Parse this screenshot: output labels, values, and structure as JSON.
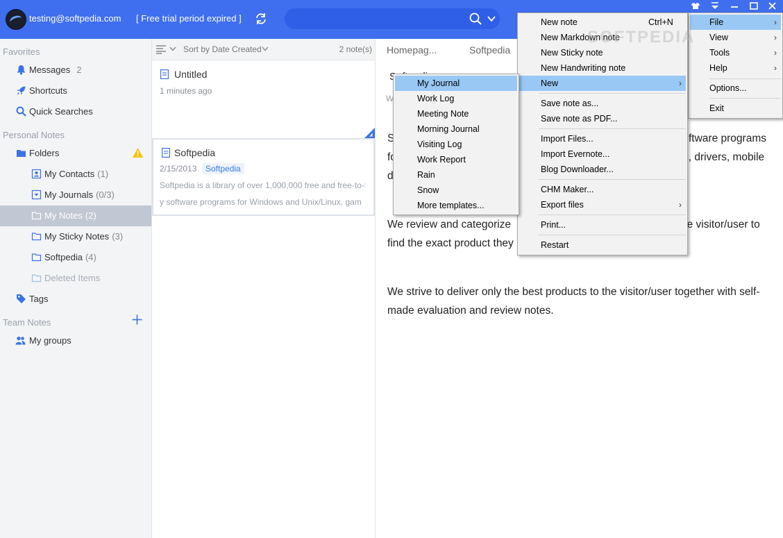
{
  "header": {
    "account_email": "testing@softpedia.com",
    "trial_status": "[ Free trial period expired ]",
    "search": {
      "value": "",
      "placeholder": ""
    }
  },
  "sidebar": {
    "favorites_label": "Favorites",
    "personal_label": "Personal Notes",
    "team_label": "Team Notes",
    "items": {
      "messages": {
        "label": "Messages",
        "count": "2"
      },
      "shortcuts": {
        "label": "Shortcuts"
      },
      "quick_searches": {
        "label": "Quick Searches"
      },
      "folders": {
        "label": "Folders"
      },
      "my_contacts": {
        "label": "My Contacts",
        "count": "(1)"
      },
      "my_journals": {
        "label": "My Journals",
        "count": "(0/3)"
      },
      "my_notes": {
        "label": "My Notes",
        "count": "(2)"
      },
      "my_sticky_notes": {
        "label": "My Sticky Notes",
        "count": "(3)"
      },
      "softpedia": {
        "label": "Softpedia",
        "count": "(4)"
      },
      "deleted_items": {
        "label": "Deleted Items"
      },
      "tags": {
        "label": "Tags"
      },
      "my_groups": {
        "label": "My groups"
      }
    }
  },
  "notelist": {
    "sort_label": "Sort by Date Created",
    "count_label": "2 note(s)",
    "notes": [
      {
        "title": "Untitled",
        "meta": "1 minutes ago"
      },
      {
        "title": "Softpedia",
        "date": "2/15/2013",
        "tag": "Softpedia",
        "snippet1": "Softpedia is a library of over 1,000,000 free and free-to-tr",
        "snippet2": "y software programs for Windows and Unix/Linux, gam"
      }
    ]
  },
  "editor": {
    "tabs": [
      "Homepag...",
      "Softpedia"
    ],
    "title_partial": "Softpedi",
    "sub_partial": "W",
    "p1_l1": "S",
    "p1_l1_right": "ftware programs",
    "p1_l2": "fo",
    "p1_l2_right": "s, drivers, mobile",
    "p1_l3": "d",
    "p2_l1": "We review and categorize",
    "p2_l1_right": "he visitor/user to",
    "p2_l2": "find the exact product they",
    "p3_l1": "We strive to deliver only the best products to the visitor/user together with self-",
    "p3_l2": "made evaluation and review notes."
  },
  "main_menu": {
    "items": [
      "File",
      "View",
      "Tools",
      "Help",
      "Options...",
      "Exit"
    ]
  },
  "file_menu": {
    "new_note": "New note",
    "new_note_key": "Ctrl+N",
    "new_markdown": "New Markdown note",
    "new_sticky": "New Sticky note",
    "new_handwriting": "New Handwriting note",
    "new": "New",
    "save_as": "Save note as...",
    "save_pdf": "Save note as PDF...",
    "import_files": "Import Files...",
    "import_evernote": "Import Evernote...",
    "blog_downloader": "Blog Downloader...",
    "chm_maker": "CHM Maker...",
    "export_files": "Export files",
    "print": "Print...",
    "restart": "Restart"
  },
  "new_submenu": {
    "items": [
      "My Journal",
      "Work Log",
      "Meeting Note",
      "Morning Journal",
      "Visiting Log",
      "Work Report",
      "Rain",
      "Snow",
      "More templates..."
    ]
  },
  "watermark": "SOFTPEDIA",
  "colors": {
    "accent": "#3f6fef",
    "menu_highlight": "#99c8f5",
    "sidebar_selected": "#c1c7d3",
    "tag_text": "#3b7ddd"
  }
}
